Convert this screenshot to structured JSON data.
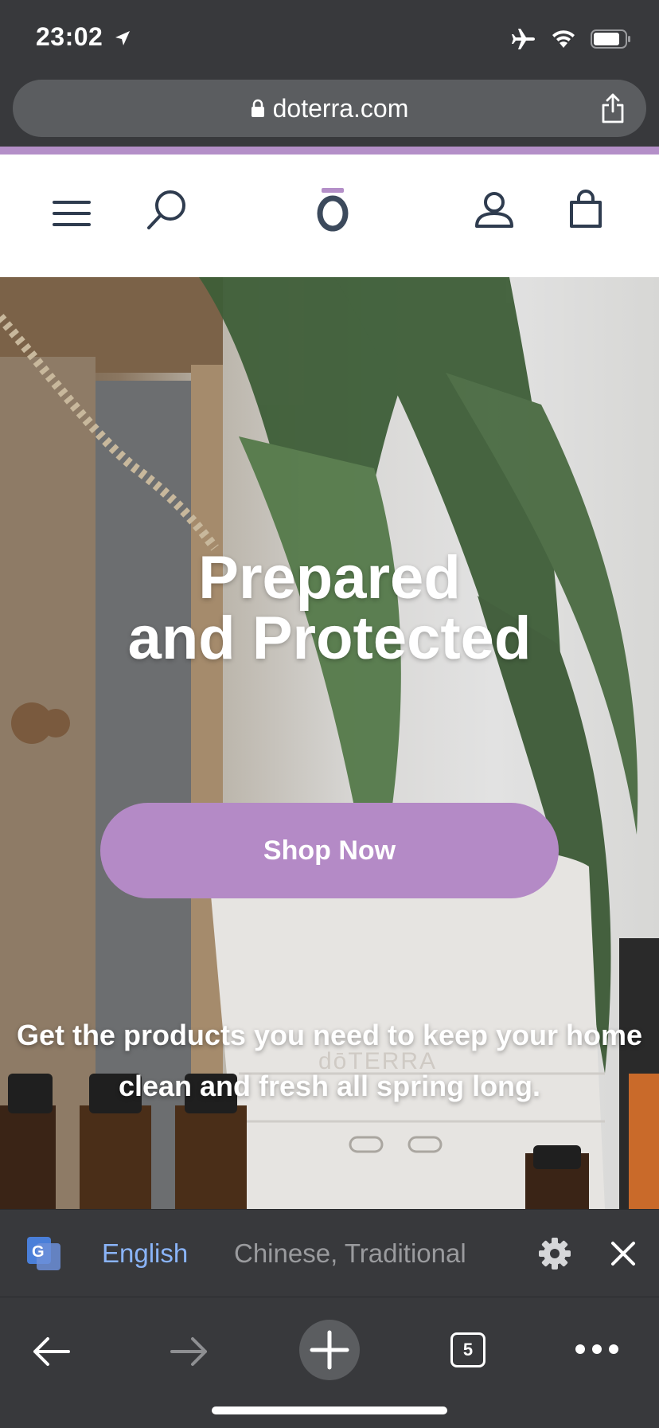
{
  "status_bar": {
    "time": "23:02"
  },
  "browser": {
    "url": "doterra.com"
  },
  "site_header": {
    "logo": "ō"
  },
  "hero": {
    "title_line1": "Prepared",
    "title_line2": "and Protected",
    "cta_label": "Shop Now",
    "subtitle": "Get the products you need to keep your home clean and fresh all spring long.",
    "diffuser_brand": "dōTERRA"
  },
  "translate_bar": {
    "source_language": "English",
    "target_language": "Chinese, Traditional"
  },
  "toolbar": {
    "tab_count": "5"
  },
  "colors": {
    "accent": "#b48fc8",
    "button": "#b48ac6",
    "chrome": "#38393c",
    "translate_active": "#8ab4f8"
  }
}
